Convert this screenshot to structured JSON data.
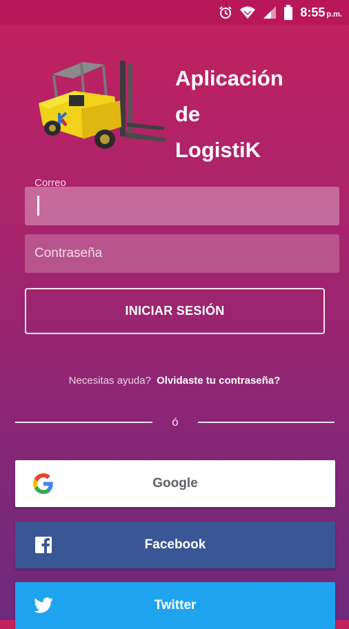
{
  "status_bar": {
    "time": "8:55",
    "ampm": "p.m.",
    "icons": [
      "alarm-icon",
      "wifi-icon",
      "signal-icon",
      "battery-icon"
    ]
  },
  "header": {
    "logo_icon": "forklift-icon",
    "title": "Aplicación\nde\nLogistiK"
  },
  "login_form": {
    "email_label": "Correo",
    "email_value": "",
    "password_placeholder": "Contraseña",
    "submit_label": "INICIAR SESIÓN"
  },
  "help": {
    "question": "Necesitas ayuda?",
    "link": "Olvidaste tu contraseña?"
  },
  "divider": {
    "text": "ó"
  },
  "social": {
    "google": {
      "label": "Google",
      "icon": "google-icon"
    },
    "facebook": {
      "label": "Facebook",
      "icon": "facebook-icon"
    },
    "twitter": {
      "label": "Twitter",
      "icon": "twitter-icon"
    }
  },
  "colors": {
    "gradient_top": "#c3215e",
    "gradient_bottom": "#6d2a7c",
    "facebook": "#3a5795",
    "twitter": "#20a3ef"
  }
}
